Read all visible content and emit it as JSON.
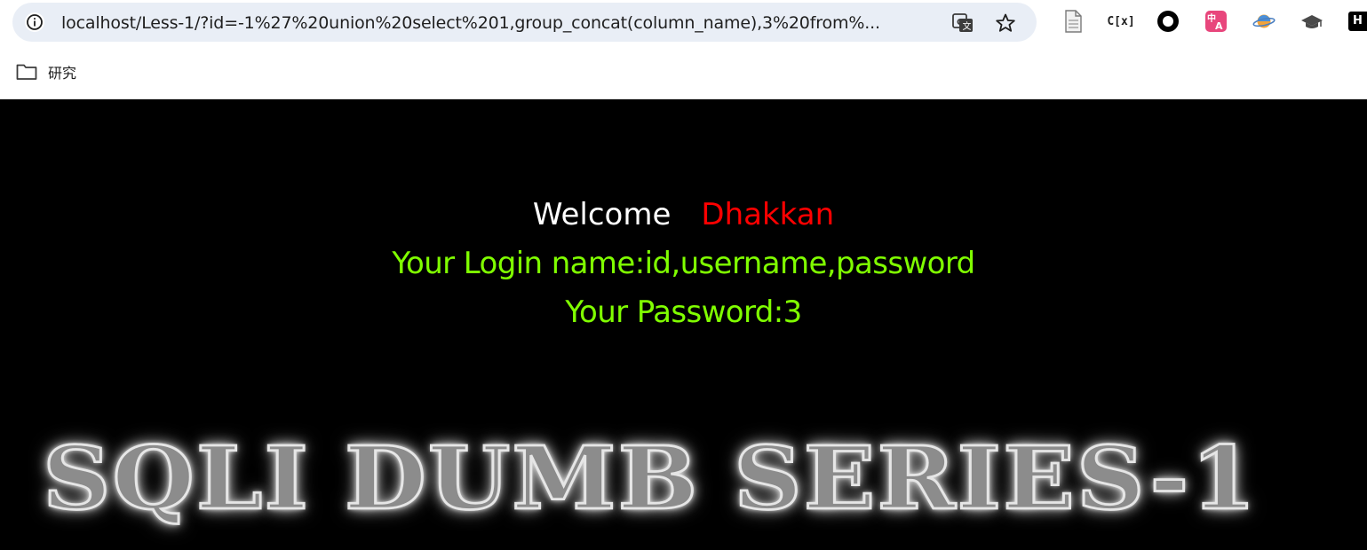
{
  "browser": {
    "url": "localhost/Less-1/?id=-1%27%20union%20select%201,group_concat(column_name),3%20from%...",
    "bookmark_folder": "研究",
    "extensions": {
      "cx_label": "C[x]",
      "h_label": "H"
    }
  },
  "page": {
    "welcome_label": "Welcome",
    "user_name": "Dhakkan",
    "login_line": "Your Login name:id,username,password",
    "password_line": "Your Password:3",
    "banner": "SQLI DUMB SERIES-1"
  },
  "colors": {
    "background": "#000000",
    "welcome": "#ffffff",
    "user_name": "#ff0000",
    "result_text": "#80ff00"
  }
}
